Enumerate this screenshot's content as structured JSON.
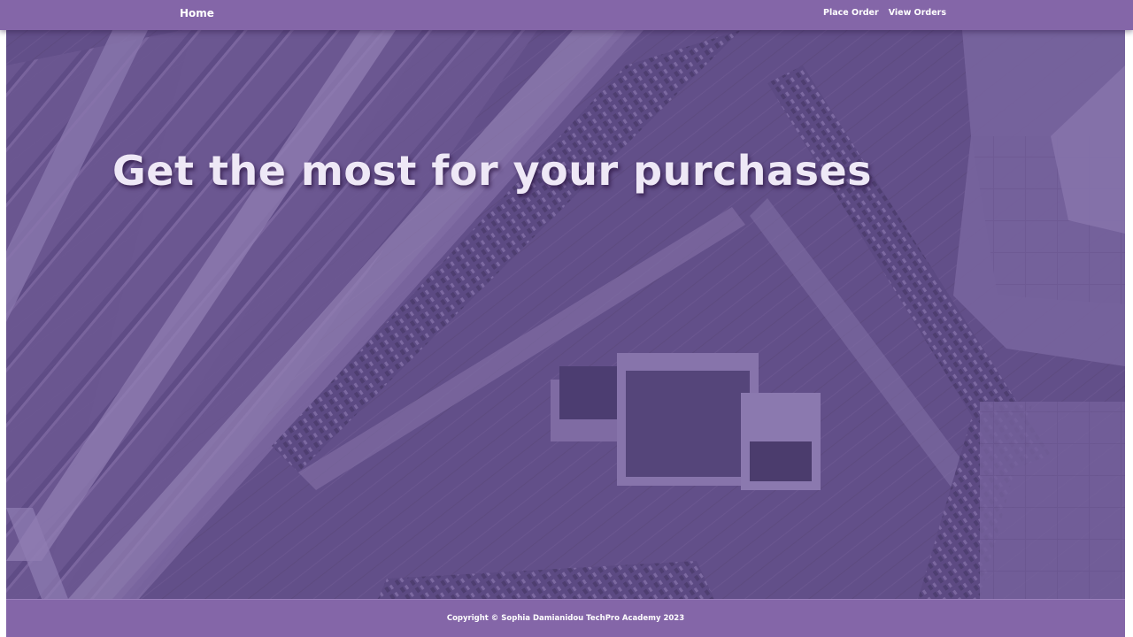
{
  "navbar": {
    "home_label": "Home",
    "links": [
      {
        "label": "Place Order"
      },
      {
        "label": "View Orders"
      }
    ]
  },
  "hero": {
    "title": "Get the most for your purchases"
  },
  "footer": {
    "copyright": "Copyright © Sophia Damianidou TechPro Academy 2023"
  },
  "colors": {
    "brand": "#8466a8",
    "hero_overlay": "#6a5590",
    "text_light": "#ffffff"
  }
}
